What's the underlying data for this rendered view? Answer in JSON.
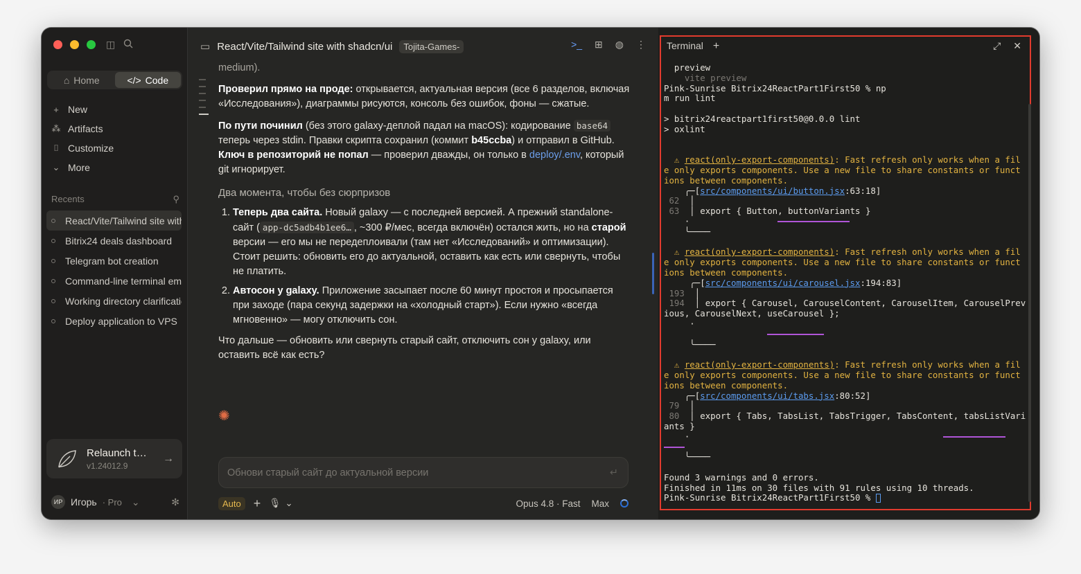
{
  "sidebar": {
    "tabs": {
      "home": "Home",
      "code": "Code"
    },
    "nav": [
      "New",
      "Artifacts",
      "Customize",
      "More"
    ],
    "recents_label": "Recents",
    "recents": [
      "React/Vite/Tailwind site with shadcn/ui",
      "Bitrix24 deals dashboard",
      "Telegram bot creation",
      "Command-line terminal emulator",
      "Working directory clarification",
      "Deploy application to VPS"
    ],
    "update": {
      "title": "Relaunch to update",
      "version": "v1.24012.9"
    },
    "user": {
      "initials": "ИР",
      "name": "Игорь",
      "plan": "· Pro"
    }
  },
  "main": {
    "title": "React/Vite/Tailwind site with shadcn/ui",
    "branch": "Tojita-Games-",
    "top_text": "medium).",
    "p1_bold": "Проверил прямо на проде:",
    "p1_text": " открывается, актуальная версия (все 6 разделов, включая «Исследования»), диаграммы рисуются, консоль без ошибок, фоны — сжатые.",
    "p2_bold": "По пути починил",
    "p2_a": " (без этого galaxy-деплой падал на macOS): кодирование ",
    "p2_code": "base64",
    "p2_b": " теперь через stdin. Правки скрипта сохранил (коммит ",
    "p2_commit": "b45ccba",
    "p2_c": ") и отправил в GitHub. ",
    "p2_bold2": "Ключ в репозиторий не попал",
    "p2_d": " — проверил дважды, он только в ",
    "p2_link": "deploy/.env",
    "p2_e": ", который git игнорирует.",
    "h3": "Два момента, чтобы без сюрпризов",
    "li1_bold": "Теперь два сайта.",
    "li1_a": " Новый galaxy — с последней версией. А прежний standalone-сайт (",
    "li1_code": "app-dc5adb4b1ee6…",
    "li1_b": ", ~300 ₽/мес, всегда включён) остался жить, но на ",
    "li1_bold2": "старой",
    "li1_c": " версии — его мы не передеплоивали (там нет «Исследований» и оптимизации). Стоит решить: обновить его до актуальной, оставить как есть или свернуть, чтобы не платить.",
    "li2_bold": "Автосон у galaxy.",
    "li2_a": " Приложение засыпает после 60 минут простоя и просыпается при заходе (пара секунд задержки на «холодный старт»). Если нужно «всегда мгновенно» — могу отключить сон.",
    "p3": "Что дальше — обновить или свернуть старый сайт, отключить сон у galaxy, или оставить всё как есть?",
    "input_placeholder": "Обнови старый сайт до актуальной версии",
    "mode": "Auto",
    "model": "Opus 4.8 · Fast",
    "effort": "Max"
  },
  "terminal": {
    "tab": "Terminal",
    "l1": "  preview",
    "l2": "    vite preview",
    "l3": "Pink-Sunrise Bitrix24ReactPart1First50 % np",
    "l4": "m run lint",
    "l5": "> bitrix24reactpart1first50@0.0.0 lint",
    "l6": "> oxlint",
    "w_rule": "react(only-export-components)",
    "w_msg1": ": Fast refresh only works when a fil",
    "w_msg2": "e only exports components. Use a new file to share constants or funct",
    "w_msg3": "ions between components.",
    "f1": "src/components/ui/button.jsx",
    "f1pos": ":63:18]",
    "f1n1": " 62",
    "f1n2": " 63",
    "f1code": "export { Button, buttonVariants }",
    "f2": "src/components/ui/carousel.jsx",
    "f2pos": ":194:83]",
    "f2n1": " 193",
    "f2n2": " 194",
    "f2code": "export { Carousel, CarouselContent, CarouselItem, CarouselPrev",
    "f2code2": "ious, CarouselNext, useCarousel };",
    "f3": "src/components/ui/tabs.jsx",
    "f3pos": ":80:52]",
    "f3n1": " 79",
    "f3n2": " 80",
    "f3code": "export { Tabs, TabsList, TabsTrigger, TabsContent, tabsListVari",
    "f3code2": "ants }",
    "s1": "Found 3 warnings and 0 errors.",
    "s2": "Finished in 11ms on 30 files with 91 rules using 10 threads.",
    "s3": "Pink-Sunrise Bitrix24ReactPart1First50 % "
  }
}
